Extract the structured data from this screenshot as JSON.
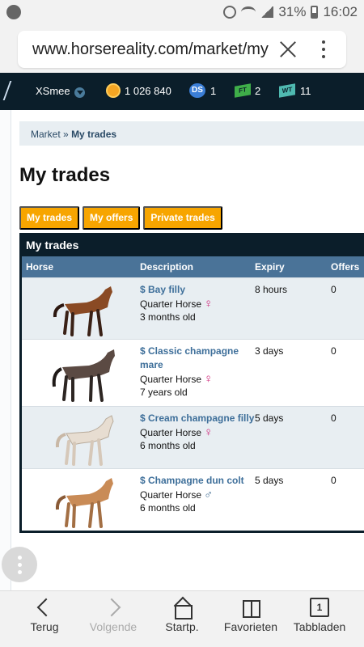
{
  "status": {
    "battery": "31%",
    "time": "16:02",
    "icons": [
      "spotify-icon",
      "alarm-icon",
      "wifi-icon",
      "signal-icon",
      "battery-icon"
    ]
  },
  "browser": {
    "url": "www.horsereality.com/market/my",
    "progress_color": "#6b63c9"
  },
  "nav": {
    "username": "XSmee",
    "coins": "1 026 840",
    "ds": "1",
    "ft": "2",
    "wt": "11",
    "ds_label": "DS",
    "ft_label": "FT",
    "wt_label": "WT"
  },
  "breadcrumb": {
    "parent": "Market",
    "separator": "»",
    "current": "My trades"
  },
  "page": {
    "title": "My trades",
    "tabs": [
      "My trades",
      "My offers",
      "Private trades"
    ]
  },
  "table": {
    "title": "My trades",
    "columns": [
      "Horse",
      "Description",
      "Expiry",
      "Offers"
    ],
    "rows": [
      {
        "title": "$ Bay filly",
        "breed": "Quarter Horse",
        "sex": "♀",
        "age": "3 months old",
        "expiry": "8 hours",
        "offers": "0",
        "coat": "#8a4a24"
      },
      {
        "title": "$ Classic champagne mare",
        "breed": "Quarter Horse",
        "sex": "♀",
        "age": "7 years old",
        "expiry": "3 days",
        "offers": "0",
        "coat": "#5b4a43"
      },
      {
        "title": "$ Cream champagne filly",
        "breed": "Quarter Horse",
        "sex": "♀",
        "age": "6 months old",
        "expiry": "5 days",
        "offers": "0",
        "coat": "#e7ddd1"
      },
      {
        "title": "$ Champagne dun colt",
        "breed": "Quarter Horse",
        "sex": "♂",
        "age": "6 months old",
        "expiry": "5 days",
        "offers": "0",
        "coat": "#c98b56"
      }
    ]
  },
  "bottom_nav": [
    "Terug",
    "Volgende",
    "Startp.",
    "Favorieten",
    "Tabbladen"
  ],
  "tab_count": "1"
}
